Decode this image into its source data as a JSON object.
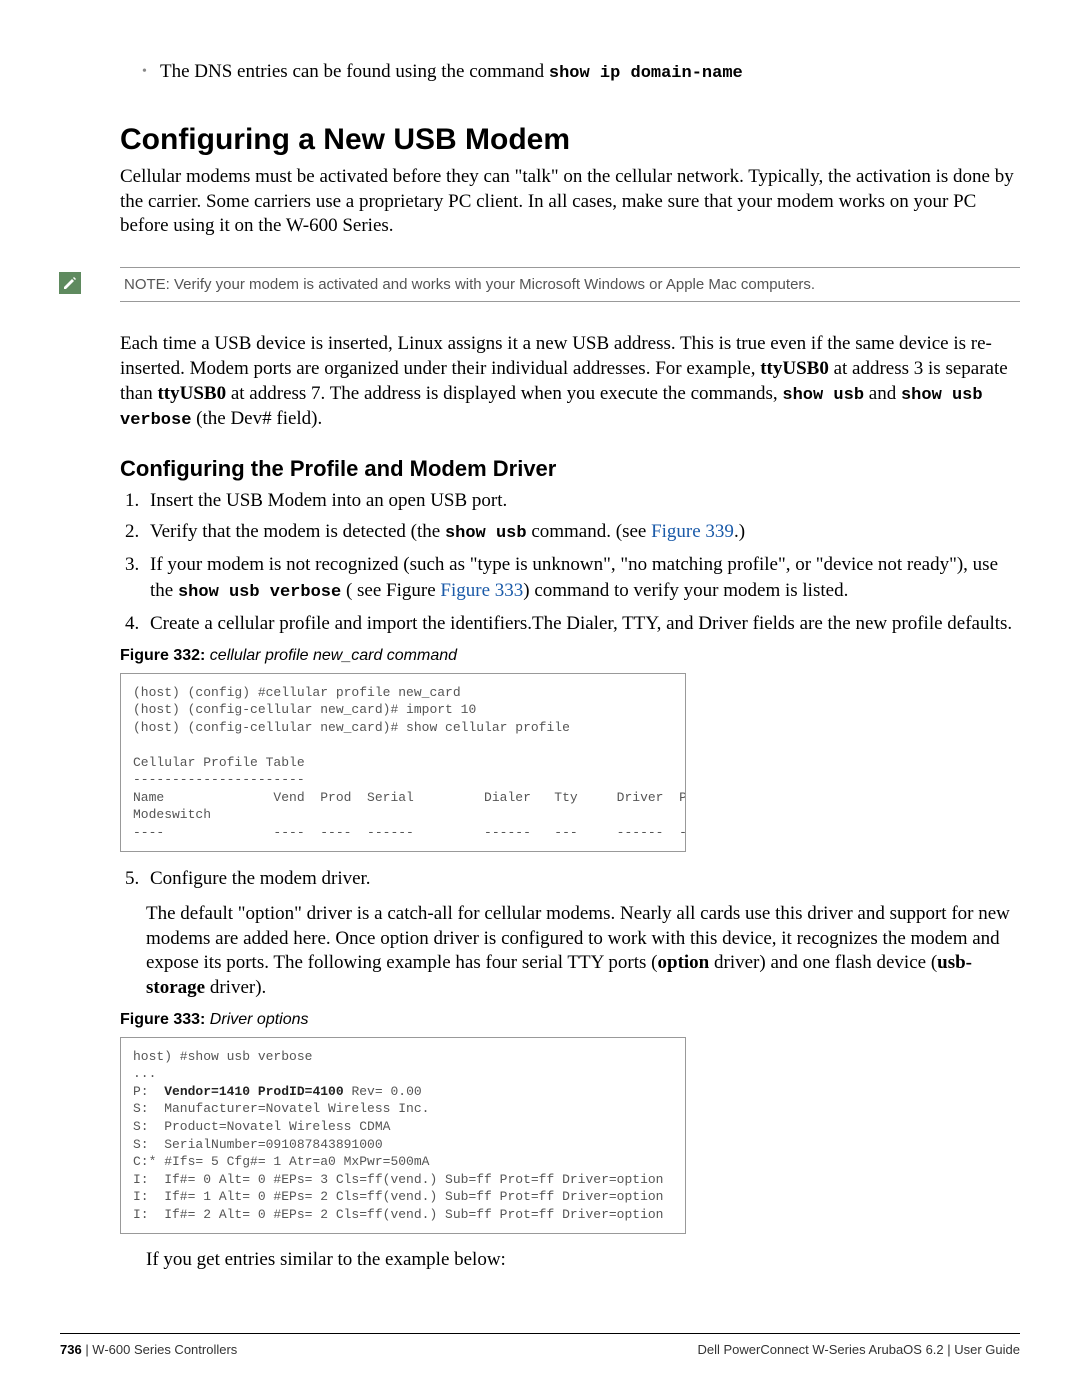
{
  "bullet1_pre": "The DNS entries can be found using the command ",
  "bullet1_cmd": "show ip domain-name",
  "h1": "Configuring a New USB Modem",
  "p1": "Cellular modems must be activated before they can \"talk\" on the cellular network. Typically, the activation is done by the carrier. Some carriers use a proprietary PC client. In all cases, make sure that your modem works on your PC before using it on the W-600 Series.",
  "note": "NOTE: Verify your modem is activated and works with your Microsoft Windows or Apple Mac computers.",
  "p2_a": "Each time a USB device is inserted, Linux assigns it a new USB address. This is true even if the same device is re-inserted. Modem ports are organized under their individual addresses. For example, ",
  "p2_b": "ttyUSB0",
  "p2_c": " at address 3 is separate than ",
  "p2_d": "ttyUSB0",
  "p2_e": " at address 7. The address is displayed when you execute the commands, ",
  "p2_f": "show usb",
  "p2_g": " and ",
  "p2_h": "show usb verbose",
  "p2_i": " (the Dev# field).",
  "h2": "Configuring the Profile and Modem Driver",
  "step1": "Insert the USB Modem into an open USB port.",
  "step2_a": "Verify that the modem is detected (the ",
  "step2_cmd": "show usb",
  "step2_b": " command. (see ",
  "step2_ref": "Figure 339",
  "step2_c": ".)",
  "step3_a": "If your modem is not recognized (such as \"type is unknown\", \"no matching profile\", or \"device not ready\"), use the ",
  "step3_cmd": "show usb verbose",
  "step3_b": " ( see Figure ",
  "step3_ref": "Figure 333",
  "step3_c": ") command to verify your modem is listed.",
  "step4": "Create a cellular profile and import the identifiers.The Dialer, TTY, and Driver fields are the new profile defaults.",
  "fig332_num": "Figure 332:",
  "fig332_title": " cellular profile new_card command",
  "code332": "(host) (config) #cellular profile new_card\n(host) (config-cellular new_card)# import 10\n(host) (config-cellular new_card)# show cellular profile\n\nCellular Profile Table\n----------------------\nName              Vend  Prod  Serial         Dialer   Tty     Driver  Priority  \nModeswitch\n----              ----  ----  ------         ------   ---     ------  --------  --",
  "step5": "Configure the modem driver.",
  "step5_p_a": "The default \"option\" driver is a catch-all for cellular modems. Nearly all cards use this driver and support for new modems are added here. Once option driver is configured to work with this device, it recognizes the modem and expose its ports. The following example has four serial TTY ports (",
  "step5_p_b": "option",
  "step5_p_c": " driver) and one flash device (",
  "step5_p_d": "usb-storage",
  "step5_p_e": " driver).",
  "fig333_num": "Figure 333:",
  "fig333_title": " Driver options",
  "code333_pre": "host) #show usb verbose\n...\nP:  ",
  "code333_bold": "Vendor=1410 ProdID=4100",
  "code333_post": " Rev= 0.00\nS:  Manufacturer=Novatel Wireless Inc.\nS:  Product=Novatel Wireless CDMA\nS:  SerialNumber=091087843891000\nC:* #Ifs= 5 Cfg#= 1 Atr=a0 MxPwr=500mA\nI:  If#= 0 Alt= 0 #EPs= 3 Cls=ff(vend.) Sub=ff Prot=ff Driver=option\nI:  If#= 1 Alt= 0 #EPs= 2 Cls=ff(vend.) Sub=ff Prot=ff Driver=option\nI:  If#= 2 Alt= 0 #EPs= 2 Cls=ff(vend.) Sub=ff Prot=ff Driver=option",
  "tail_p": "If you get entries similar to the example below:",
  "footer_page": "736",
  "footer_left": " | W-600 Series Controllers",
  "footer_right": "Dell PowerConnect W-Series ArubaOS 6.2  |  User Guide"
}
